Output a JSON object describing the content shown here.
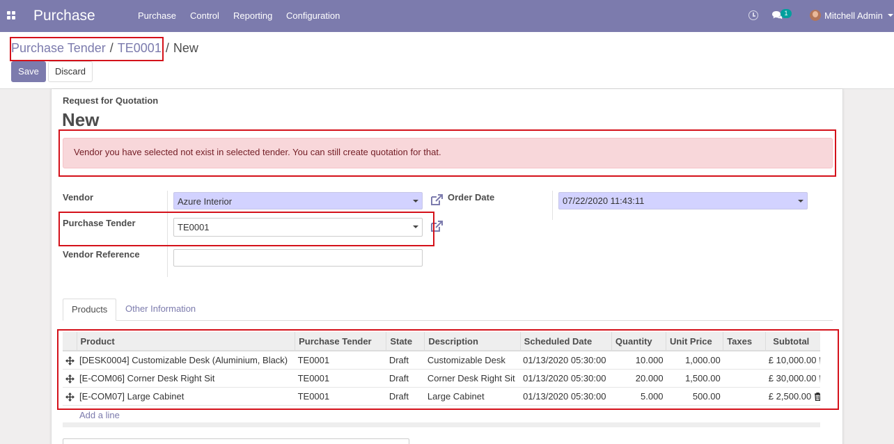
{
  "topbar": {
    "app_name": "Purchase",
    "menu": [
      "Purchase",
      "Control",
      "Reporting",
      "Configuration"
    ],
    "chat_count": "1",
    "user_name": "Mitchell Admin",
    "icons": [
      "apps-icon",
      "clock-icon",
      "chat-icon",
      "avatar"
    ]
  },
  "breadcrumb": {
    "items": [
      "Purchase Tender",
      "TE0001"
    ],
    "separator": "/",
    "current": "New"
  },
  "buttons": {
    "save": "Save",
    "discard": "Discard"
  },
  "form": {
    "doc_label": "Request for Quotation",
    "doc_name": "New",
    "alert": "Vendor you have selected not exist in selected tender. You can still create quotation for that.",
    "vendor_label": "Vendor",
    "vendor_value": "Azure Interior",
    "tender_label": "Purchase Tender",
    "tender_value": "TE0001",
    "vendor_ref_label": "Vendor Reference",
    "vendor_ref_value": "",
    "order_date_label": "Order Date",
    "order_date_value": "07/22/2020 11:43:11"
  },
  "tabs": [
    "Products",
    "Other Information"
  ],
  "table": {
    "columns": [
      "Product",
      "Purchase Tender",
      "State",
      "Description",
      "Scheduled Date",
      "Quantity",
      "Unit Price",
      "Taxes",
      "Subtotal"
    ],
    "rows": [
      [
        "[DESK0004] Customizable Desk (Aluminium, Black)",
        "TE0001",
        "Draft",
        "Customizable Desk",
        "01/13/2020 05:30:00",
        "10.000",
        "1,000.00",
        "",
        "£ 10,000.00"
      ],
      [
        "[E-COM06] Corner Desk Right Sit",
        "TE0001",
        "Draft",
        "Corner Desk Right Sit",
        "01/13/2020 05:30:00",
        "20.000",
        "1,500.00",
        "",
        "£ 30,000.00"
      ],
      [
        "[E-COM07] Large Cabinet",
        "TE0001",
        "Draft",
        "Large Cabinet",
        "01/13/2020 05:30:00",
        "5.000",
        "500.00",
        "",
        "£ 2,500.00"
      ]
    ],
    "add_line": "Add a line"
  },
  "colors": {
    "brand": "#7c7bad",
    "alert_bg": "#f8d7da",
    "alert_text": "#721c24",
    "highlight": "#d4111a",
    "required_bg": "#d2d2ff"
  }
}
